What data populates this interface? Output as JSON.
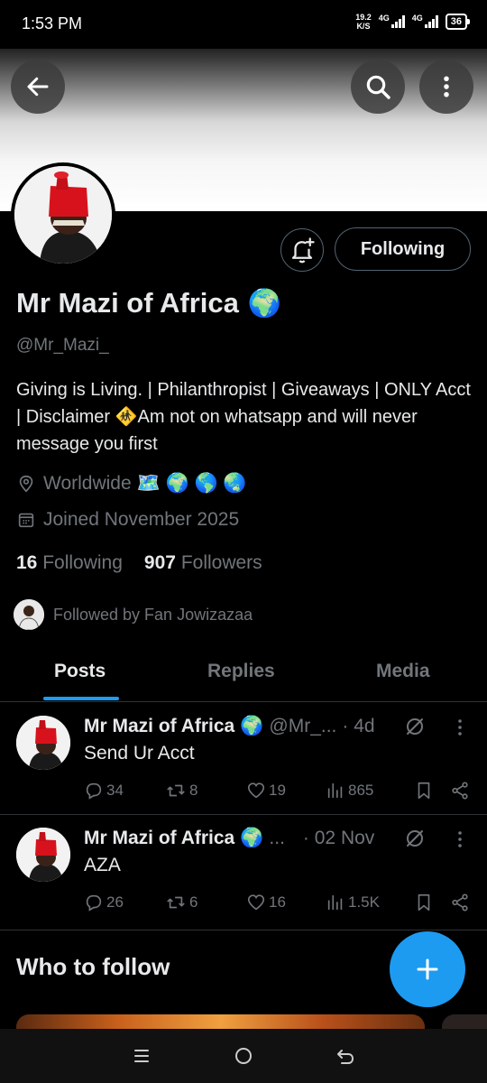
{
  "status_bar": {
    "time": "1:53 PM",
    "speed_value": "19.2",
    "speed_unit": "K/S",
    "net1": "4G",
    "net2": "4G",
    "battery": "36"
  },
  "profile": {
    "display_name": "Mr Mazi of Africa",
    "handle": "@Mr_Mazi_",
    "bio": "Giving is Living. | Philanthropist | Giveaways | ONLY Acct |  Disclaimer 🚸Am not on whatsapp and will never message you first",
    "location": "Worldwide 🗺️ 🌍 🌎 🌏",
    "joined": "Joined November 2025",
    "following_count": "16",
    "following_label": "Following",
    "followers_count": "907",
    "followers_label": "Followers",
    "followed_by": "Followed by Fan Jowizazaa",
    "follow_button": "Following",
    "name_emoji": "🌍"
  },
  "tabs": [
    {
      "label": "Posts",
      "active": true
    },
    {
      "label": "Replies",
      "active": false
    },
    {
      "label": "Media",
      "active": false
    }
  ],
  "posts": [
    {
      "name": "Mr Mazi of Africa",
      "emoji": "🌍",
      "handle": "@Mr_...",
      "time": "· 4d",
      "text": "Send Ur Acct",
      "replies": "34",
      "reposts": "8",
      "likes": "19",
      "views": "865"
    },
    {
      "name": "Mr Mazi of Africa",
      "emoji": "🌍",
      "handle": "...",
      "time": "· 02 Nov",
      "text": "AZA",
      "replies": "26",
      "reposts": "6",
      "likes": "16",
      "views": "1.5K"
    }
  ],
  "who_to_follow": "Who to follow",
  "colors": {
    "accent": "#1d9bf0",
    "muted": "#71767b",
    "border": "#2f3336"
  }
}
